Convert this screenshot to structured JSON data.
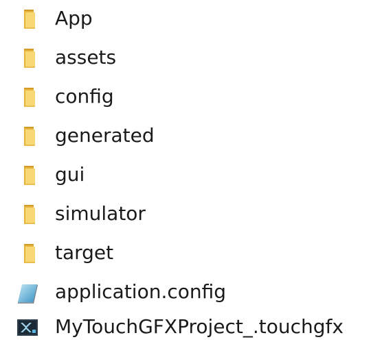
{
  "explorer": {
    "colors": {
      "folder_front": "#F8D775",
      "folder_back": "#E7B43F",
      "text": "#1a1a1a"
    },
    "items": [
      {
        "label": "App",
        "icon": "folder-icon"
      },
      {
        "label": "assets",
        "icon": "folder-icon"
      },
      {
        "label": "config",
        "icon": "folder-icon"
      },
      {
        "label": "generated",
        "icon": "folder-icon"
      },
      {
        "label": "gui",
        "icon": "folder-icon"
      },
      {
        "label": "simulator",
        "icon": "folder-icon"
      },
      {
        "label": "target",
        "icon": "folder-icon"
      },
      {
        "label": "application.config",
        "icon": "config-file-icon"
      },
      {
        "label": "MyTouchGFXProject_.touchgfx",
        "icon": "touchgfx-file-icon"
      }
    ]
  }
}
